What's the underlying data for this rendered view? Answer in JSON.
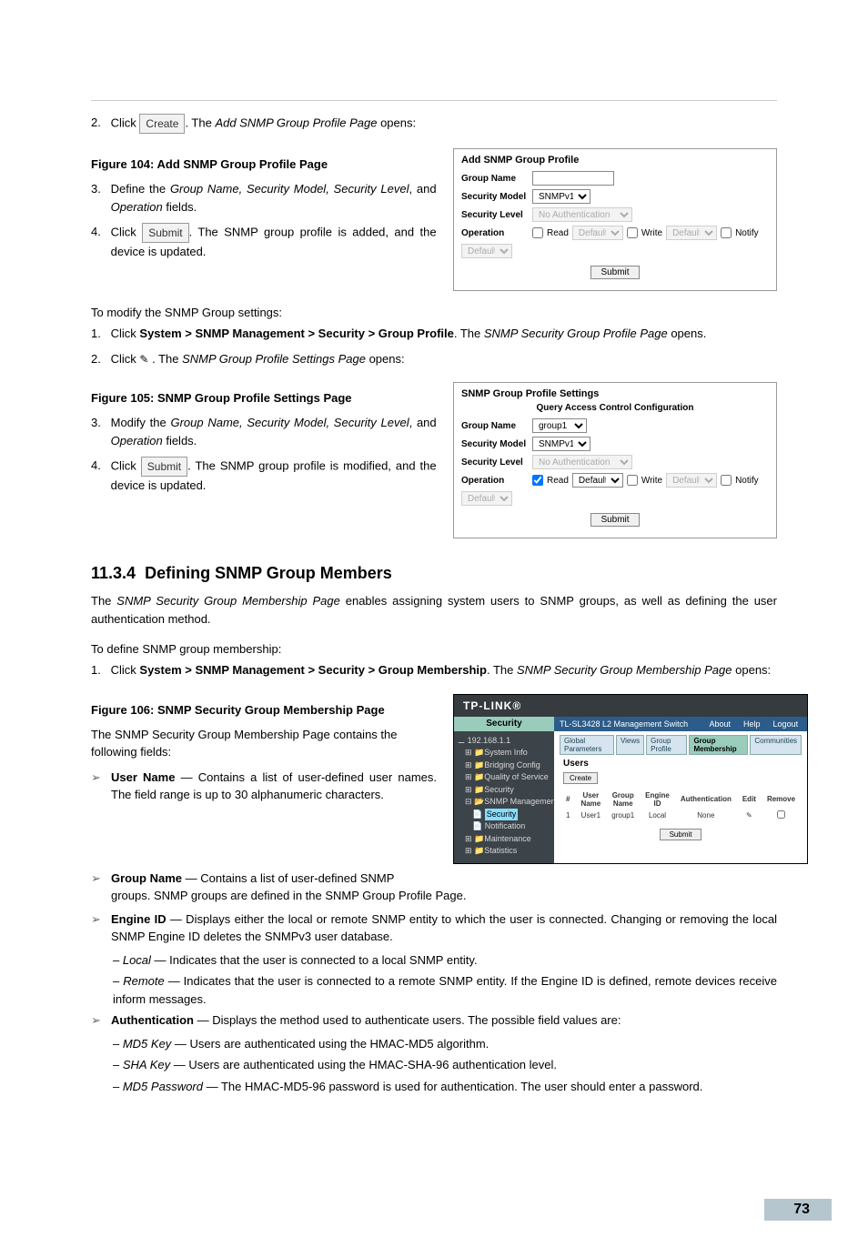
{
  "page_number": "73",
  "step2": {
    "num": "2.",
    "t1": "Click ",
    "btn": "Create",
    "t2": ". The ",
    "i": "Add SNMP Group Profile Page",
    "t3": " opens:"
  },
  "fig104": {
    "caption": "Figure 104: Add SNMP Group Profile Page"
  },
  "step3": {
    "num": "3.",
    "t1": "Define the ",
    "i": "Group Name, Security Model, Security Level",
    "t2": ", and ",
    "i2": "Operation",
    "t3": " fields."
  },
  "step4": {
    "num": "4.",
    "t1": "Click ",
    "btn": "Submit",
    "t2": ". The SNMP group profile is added, and the device is updated."
  },
  "modify_intro": "To modify the SNMP Group settings:",
  "m1": {
    "num": "1.",
    "t1": "Click ",
    "b": "System > SNMP Management > Security > Group Profile",
    "t2": ". The ",
    "i": "SNMP Security Group Profile Page",
    "t3": " opens."
  },
  "m2": {
    "num": "2.",
    "t1": "Click ",
    "t2": " . The ",
    "i": "SNMP Group Profile Settings Page",
    "t3": " opens:"
  },
  "fig105": {
    "caption": "Figure 105: SNMP Group Profile Settings Page"
  },
  "m3": {
    "num": "3.",
    "t1": " Modify the ",
    "i": "Group Name, Security Model, Security Level",
    "t2": ", and ",
    "i2": "Operation",
    "t3": " fields."
  },
  "m4": {
    "num": "4.",
    "t1": "Click ",
    "btn": "Submit",
    "t2": ". The SNMP group profile is modified, and the device is updated."
  },
  "section": {
    "num": "11.3.4",
    "title": "Defining SNMP Group Members"
  },
  "section_intro": {
    "t1": "The ",
    "i": "SNMP Security Group Membership Page",
    "t2": " enables assigning system users to SNMP groups, as well as defining the user authentication method."
  },
  "def_intro": "To define SNMP group membership:",
  "d1": {
    "num": "1.",
    "t1": "Click ",
    "b": "System > SNMP Management > Security > Group Membership",
    "t2": ". The ",
    "i": "SNMP Security Group Membership Page",
    "t3": " opens:"
  },
  "fig106": {
    "caption": "Figure 106: SNMP Security Group Membership Page"
  },
  "fields_intro": "The SNMP Security Group Membership Page contains the following fields:",
  "f_user": {
    "b": "User Name",
    "t": " — Contains a list of user-defined user names. The field range is up to 30 alphanumeric characters."
  },
  "f_group": {
    "b": "Group Name",
    "t1": " — Contains a list of user-defined SNMP",
    "t2": "groups. SNMP groups are defined in the SNMP Group Profile Page."
  },
  "f_engine": {
    "b": "Engine ID",
    "t": " — Displays either the local or remote SNMP entity to which the user is connected. Changing or removing the local SNMP Engine ID deletes the SNMPv3 user database."
  },
  "f_engine_local": {
    "i": "Local",
    "t": " — Indicates that the user is connected to a local SNMP entity."
  },
  "f_engine_remote": {
    "i": "Remote",
    "t": " — Indicates that the user is connected to a remote SNMP entity. If the Engine ID is defined, remote devices receive inform messages."
  },
  "f_auth": {
    "b": "Authentication",
    "t": " — Displays the method used to authenticate users. The possible field values are:"
  },
  "f_auth_md5k": {
    "i": "MD5 Key",
    "t": " — Users are authenticated using the HMAC-MD5 algorithm."
  },
  "f_auth_shak": {
    "i": "SHA Key",
    "t": " — Users are authenticated using the HMAC-SHA-96 authentication level."
  },
  "f_auth_md5p": {
    "i": "MD5 Password",
    "t": " — The HMAC-MD5-96 password is used for authentication. The user should enter a password."
  },
  "panel104": {
    "title": "Add SNMP Group Profile",
    "group_name_lbl": "Group Name",
    "sec_model_lbl": "Security Model",
    "sec_model_val": "SNMPv1",
    "sec_level_lbl": "Security Level",
    "sec_level_val": "No Authentication",
    "op_lbl": "Operation",
    "read_lbl": "Read",
    "read_val": "Default",
    "write_lbl": "Write",
    "write_val": "Default",
    "notify_lbl": "Notify",
    "notify_val": "Default",
    "submit": "Submit"
  },
  "panel105": {
    "title": "SNMP Group Profile Settings",
    "qacc": "Query Access Control Configuration",
    "group_name_lbl": "Group Name",
    "group_name_val": "group1",
    "sec_model_lbl": "Security Model",
    "sec_model_val": "SNMPv1",
    "sec_level_lbl": "Security Level",
    "sec_level_val": "No Authentication",
    "op_lbl": "Operation",
    "read_lbl": "Read",
    "read_val": "Default",
    "write_lbl": "Write",
    "write_val": "Default",
    "notify_lbl": "Notify",
    "notify_val": "Default",
    "submit": "Submit"
  },
  "app106": {
    "brand": "TP-LINK®",
    "hdr_left": "TL-SL3428 L2 Management Switch",
    "hdr_about": "About",
    "hdr_help": "Help",
    "hdr_logout": "Logout",
    "side_title": "Security",
    "tree": {
      "root": "192.168.1.1",
      "n1": "System Info",
      "n2": "Bridging Config",
      "n3": "Quality of Service",
      "n4": "Security",
      "n5": "SNMP Management",
      "n5a": "Security",
      "n5b": "Notification",
      "n6": "Maintenance",
      "n7": "Statistics"
    },
    "tabs": {
      "t1": "Global Parameters",
      "t2": "Views",
      "t3": "Group Profile",
      "t4": "Group Membership",
      "t5": "Communities"
    },
    "panel_title": "Users",
    "create": "Create",
    "th": {
      "c0": "#",
      "c1": "User Name",
      "c2": "Group Name",
      "c3": "Engine ID",
      "c4": "Authentication",
      "c5": "Edit",
      "c6": "Remove"
    },
    "row": {
      "c0": "1",
      "c1": "User1",
      "c2": "group1",
      "c3": "Local",
      "c4": "None"
    },
    "submit": "Submit"
  }
}
